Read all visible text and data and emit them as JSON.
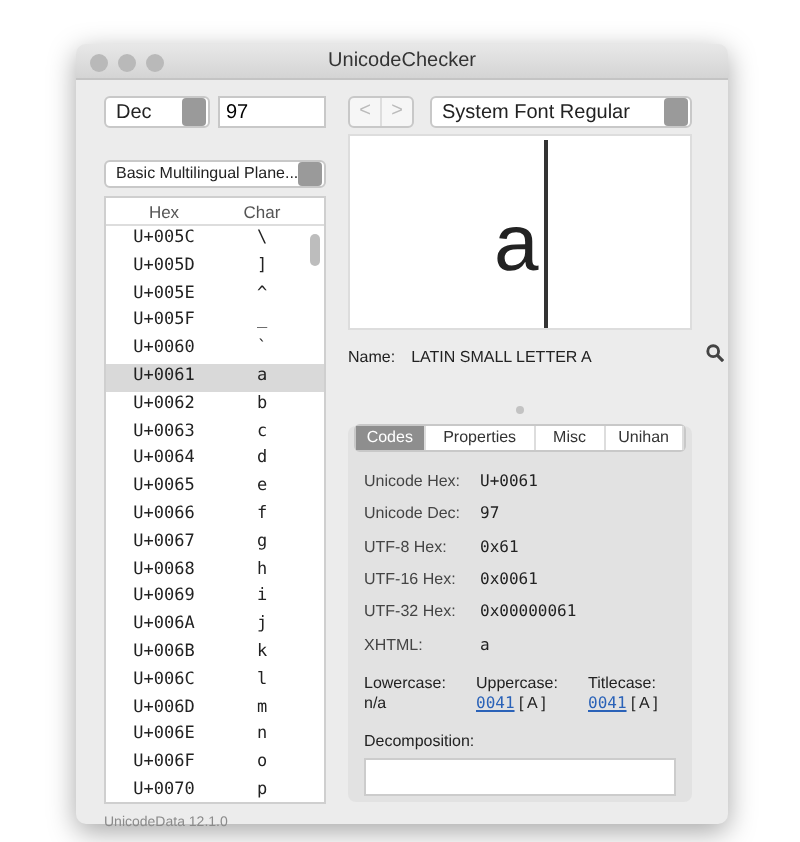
{
  "window": {
    "title": "UnicodeChecker"
  },
  "left": {
    "format_select": "Dec",
    "number_field": "97",
    "plane_select": "Basic Multilingual Plane...",
    "table": {
      "columns": [
        "Hex",
        "Char"
      ],
      "rows": [
        {
          "hex": "U+005C",
          "char": "\\",
          "selected": false
        },
        {
          "hex": "U+005D",
          "char": "]",
          "selected": false
        },
        {
          "hex": "U+005E",
          "char": "^",
          "selected": false
        },
        {
          "hex": "U+005F",
          "char": "_",
          "selected": false
        },
        {
          "hex": "U+0060",
          "char": "`",
          "selected": false
        },
        {
          "hex": "U+0061",
          "char": "a",
          "selected": true
        },
        {
          "hex": "U+0062",
          "char": "b",
          "selected": false
        },
        {
          "hex": "U+0063",
          "char": "c",
          "selected": false
        },
        {
          "hex": "U+0064",
          "char": "d",
          "selected": false
        },
        {
          "hex": "U+0065",
          "char": "e",
          "selected": false
        },
        {
          "hex": "U+0066",
          "char": "f",
          "selected": false
        },
        {
          "hex": "U+0067",
          "char": "g",
          "selected": false
        },
        {
          "hex": "U+0068",
          "char": "h",
          "selected": false
        },
        {
          "hex": "U+0069",
          "char": "i",
          "selected": false
        },
        {
          "hex": "U+006A",
          "char": "j",
          "selected": false
        },
        {
          "hex": "U+006B",
          "char": "k",
          "selected": false
        },
        {
          "hex": "U+006C",
          "char": "l",
          "selected": false
        },
        {
          "hex": "U+006D",
          "char": "m",
          "selected": false
        },
        {
          "hex": "U+006E",
          "char": "n",
          "selected": false
        },
        {
          "hex": "U+006F",
          "char": "o",
          "selected": false
        },
        {
          "hex": "U+0070",
          "char": "p",
          "selected": false
        }
      ]
    },
    "status": "UnicodeData 12.1.0"
  },
  "right": {
    "back_symbol": "<",
    "forward_symbol": ">",
    "font_select": "System Font Regular",
    "preview_char": "a",
    "name_label": "Name:",
    "name_value": "LATIN SMALL LETTER A",
    "tabs": [
      {
        "label": "Codes",
        "selected": true
      },
      {
        "label": "Properties",
        "selected": false
      },
      {
        "label": "Misc",
        "selected": false
      },
      {
        "label": "Unihan",
        "selected": false
      }
    ],
    "codes": [
      {
        "label": "Unicode Hex:",
        "value": "U+0061"
      },
      {
        "label": "Unicode Dec:",
        "value": "97"
      },
      {
        "label": "UTF-8 Hex:",
        "value": "0x61"
      },
      {
        "label": "UTF-16 Hex:",
        "value": "0x0061"
      },
      {
        "label": "UTF-32 Hex:",
        "value": "0x00000061"
      },
      {
        "label": "XHTML:",
        "value": "a"
      }
    ],
    "cases": [
      {
        "label": "Lowercase:",
        "value": "n/a"
      },
      {
        "label": "Uppercase:",
        "link": "0041",
        "value": "[ A ]"
      },
      {
        "label": "Titlecase:",
        "link": "0041",
        "value": "[ A ]"
      }
    ],
    "decomposition_label": "Decomposition:"
  }
}
